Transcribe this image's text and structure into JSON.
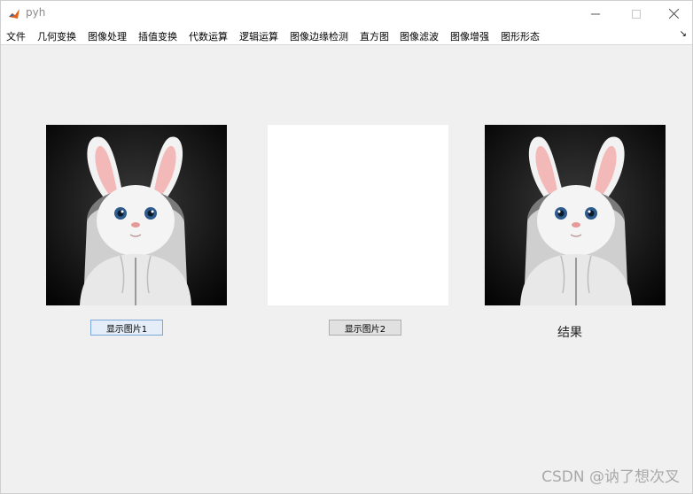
{
  "window": {
    "title": "pyh",
    "controls": {
      "minimize": "—",
      "maximize": "☐",
      "close": "✕"
    }
  },
  "menu": {
    "items": [
      "文件",
      "几何变换",
      "图像处理",
      "插值变换",
      "代数运算",
      "逻辑运算",
      "图像边缘检测",
      "直方图",
      "图像滤波",
      "图像增强",
      "图形形态"
    ],
    "overflow_arrow": "↘"
  },
  "panels": {
    "image1": {
      "content": "white bunny in hoodie on dark background"
    },
    "image2": {
      "content": "blank white"
    },
    "result": {
      "content": "white bunny in hoodie on dark background (mirrored)"
    }
  },
  "buttons": {
    "show1": "显示图片1",
    "show2": "显示图片2"
  },
  "result_label": "结果",
  "watermark": "CSDN @讷了想次叉",
  "colors": {
    "background": "#f0f0f0",
    "panel_dark": "#0b0b0b",
    "focus_border": "#7aa7d6"
  }
}
